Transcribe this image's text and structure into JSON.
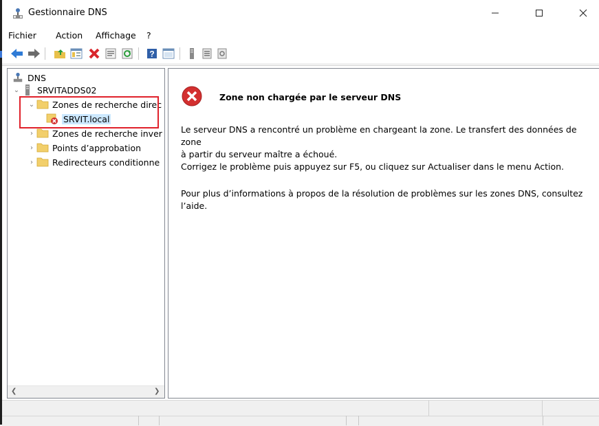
{
  "window": {
    "title": "Gestionnaire DNS",
    "controls": {
      "minimize": "minimize-icon",
      "maximize": "maximize-icon",
      "close": "close-icon"
    }
  },
  "menu": [
    "Fichier",
    "Action",
    "Affichage",
    "?"
  ],
  "toolbar": {
    "buttons": [
      "back-icon",
      "forward-icon",
      "up-folder-icon",
      "show-hide-tree-icon",
      "delete-icon",
      "properties-icon",
      "refresh-icon",
      "help-icon",
      "details-view-icon",
      "server-icon",
      "list-icon",
      "zone-properties-icon"
    ]
  },
  "tree": {
    "root": "DNS",
    "server": "SRVITADDS02",
    "items": [
      {
        "label": "Zones de recherche direc",
        "expanded": true
      },
      {
        "label": "SRVIT.local",
        "selected": true,
        "status": "error"
      },
      {
        "label": "Zones de recherche inver",
        "expanded": false
      },
      {
        "label": "Points d’approbation",
        "expanded": false
      },
      {
        "label": "Redirecteurs conditionne",
        "expanded": false
      }
    ]
  },
  "details": {
    "heading": "Zone non chargée par le serveur DNS",
    "paragraph1_line1": "Le serveur DNS a rencontré un problème en chargeant la zone. Le transfert des données de zone",
    "paragraph1_line2": "à partir du serveur maître a échoué.",
    "paragraph2": "Corrigez le problème puis appuyez sur F5, ou cliquez sur Actualiser dans le menu Action.",
    "paragraph3_line1": "Pour plus d’informations à propos de la résolution de problèmes sur les zones DNS, consultez",
    "paragraph3_line2": "l’aide."
  },
  "colors": {
    "selection": "#cce8ff",
    "highlight_box": "#e0202a",
    "error_icon": "#d32f2f",
    "folder": "#f2cf6b"
  }
}
